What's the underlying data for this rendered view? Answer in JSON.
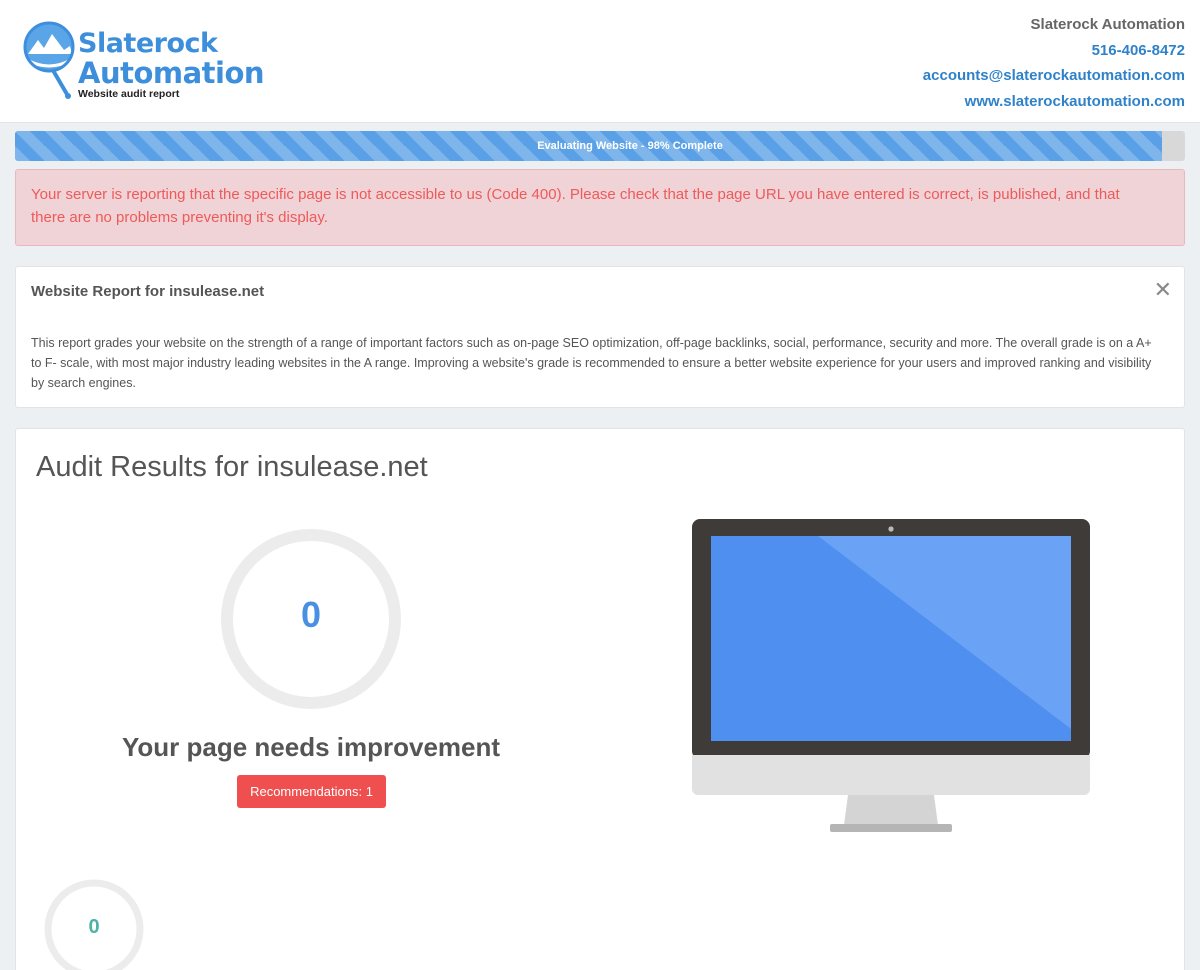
{
  "header": {
    "logo": {
      "line1": "Slaterock",
      "line2": "Automation",
      "subtitle": "Website audit report"
    },
    "contact": {
      "company": "Slaterock Automation",
      "phone": "516-406-8472",
      "email": "accounts@slaterockautomation.com",
      "website": "www.slaterockautomation.com"
    }
  },
  "progress": {
    "label": "Evaluating Website - 98% Complete",
    "percent": 98
  },
  "alert": {
    "message": "Your server is reporting that the specific page is not accessible to us (Code 400). Please check that the page URL you have entered is correct, is published, and that there are no problems preventing it's display."
  },
  "report_panel": {
    "title": "Website Report for insulease.net",
    "close_icon": "close-icon",
    "description": "This report grades your website on the strength of a range of important factors such as on-page SEO optimization, off-page backlinks, social, performance, security and more. The overall grade is on a A+ to F- scale, with most major industry leading websites in the A range. Improving a website's grade is recommended to ensure a better website experience for your users and improved ranking and visibility by search engines."
  },
  "audit_panel": {
    "title": "Audit Results for insulease.net",
    "score": "0",
    "verdict": "Your page needs improvement",
    "recommendations_label": "Recommendations: 1",
    "secondary_score": "0"
  },
  "colors": {
    "accent": "#4a90e2",
    "link": "#2f82c9",
    "alert_text": "#ee5a5a",
    "alert_bg": "#f0d3d6",
    "danger_button": "#ef4f4f",
    "secondary_score": "#4cb3a6"
  }
}
